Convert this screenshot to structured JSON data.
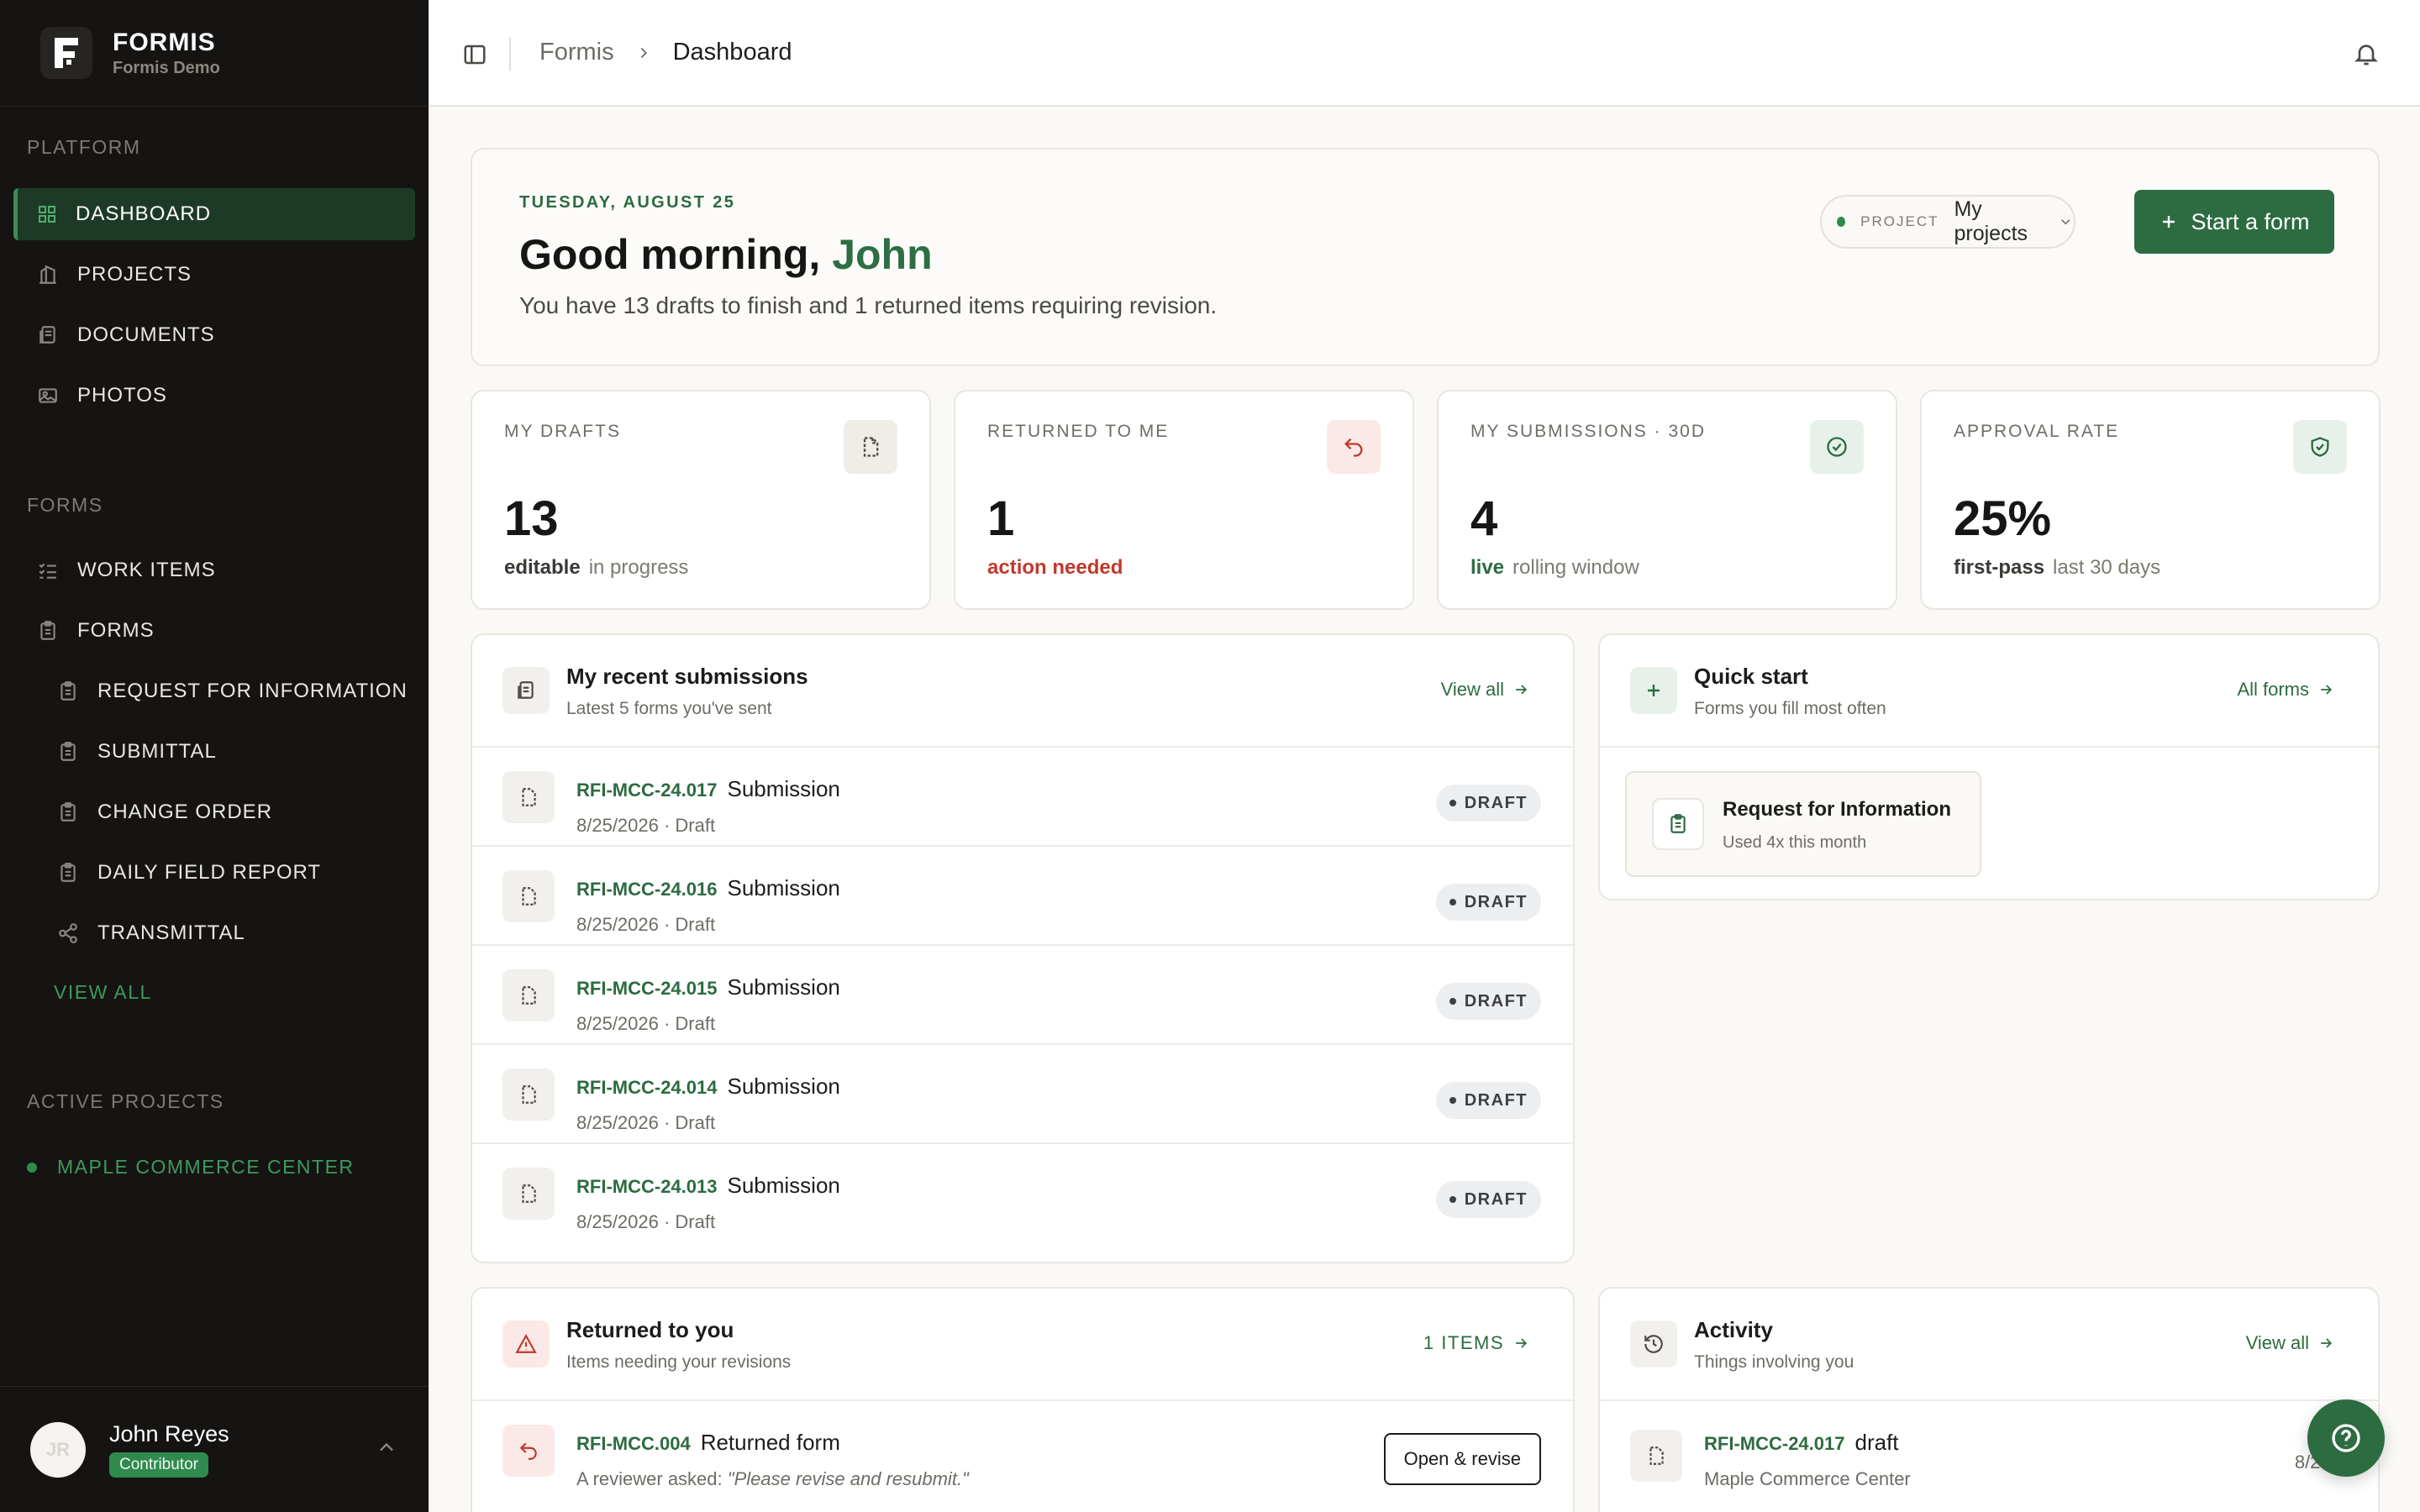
{
  "brand": {
    "name": "FORMIS",
    "subtitle": "Formis Demo"
  },
  "sidebar": {
    "platform_label": "PLATFORM",
    "platform_items": [
      {
        "label": "DASHBOARD",
        "icon": "grid-icon",
        "active": true
      },
      {
        "label": "PROJECTS",
        "icon": "building-icon"
      },
      {
        "label": "DOCUMENTS",
        "icon": "documents-icon"
      },
      {
        "label": "PHOTOS",
        "icon": "photos-icon"
      }
    ],
    "forms_label": "FORMS",
    "forms_items": [
      {
        "label": "WORK ITEMS",
        "icon": "list-check-icon"
      },
      {
        "label": "FORMS",
        "icon": "clipboard-icon"
      },
      {
        "label": "REQUEST FOR INFORMATION",
        "icon": "clipboard-icon"
      },
      {
        "label": "SUBMITTAL",
        "icon": "clipboard-icon"
      },
      {
        "label": "CHANGE ORDER",
        "icon": "clipboard-icon"
      },
      {
        "label": "DAILY FIELD REPORT",
        "icon": "clipboard-icon"
      },
      {
        "label": "TRANSMITTAL",
        "icon": "share-icon"
      }
    ],
    "view_all": "VIEW ALL",
    "active_projects_label": "ACTIVE PROJECTS",
    "active_project": "MAPLE COMMERCE CENTER"
  },
  "user": {
    "initials": "JR",
    "name": "John Reyes",
    "role": "Contributor"
  },
  "breadcrumb": {
    "root": "Formis",
    "current": "Dashboard"
  },
  "hero": {
    "date": "TUESDAY, AUGUST 25",
    "greeting": "Good morning,",
    "name": "John",
    "summary": "You have 13 drafts to finish and 1 returned items requiring revision.",
    "project_label": "PROJECT",
    "project_value": "My projects",
    "start_button": "Start a form"
  },
  "stats": [
    {
      "label": "MY DRAFTS",
      "value": "13",
      "strong": "editable",
      "muted": "in progress",
      "icon": "draft-file-icon"
    },
    {
      "label": "RETURNED TO ME",
      "value": "1",
      "strong": "action needed",
      "muted": "",
      "icon": "return-arrow-icon"
    },
    {
      "label": "MY SUBMISSIONS · 30D",
      "value": "4",
      "strong": "live",
      "muted": "rolling window",
      "icon": "check-circle-icon"
    },
    {
      "label": "APPROVAL RATE",
      "value": "25%",
      "strong": "first-pass",
      "muted": "last 30 days",
      "icon": "shield-check-icon"
    }
  ],
  "recent": {
    "title": "My recent submissions",
    "subtitle": "Latest 5 forms you've sent",
    "link": "View all",
    "rows": [
      {
        "code": "RFI-MCC-24.017",
        "title": "Submission",
        "meta": "8/25/2026 · Draft",
        "status": "DRAFT"
      },
      {
        "code": "RFI-MCC-24.016",
        "title": "Submission",
        "meta": "8/25/2026 · Draft",
        "status": "DRAFT"
      },
      {
        "code": "RFI-MCC-24.015",
        "title": "Submission",
        "meta": "8/25/2026 · Draft",
        "status": "DRAFT"
      },
      {
        "code": "RFI-MCC-24.014",
        "title": "Submission",
        "meta": "8/25/2026 · Draft",
        "status": "DRAFT"
      },
      {
        "code": "RFI-MCC-24.013",
        "title": "Submission",
        "meta": "8/25/2026 · Draft",
        "status": "DRAFT"
      }
    ]
  },
  "quick": {
    "title": "Quick start",
    "subtitle": "Forms you fill most often",
    "link": "All forms",
    "tile_title": "Request for Information",
    "tile_sub": "Used 4x this month"
  },
  "returned": {
    "title": "Returned to you",
    "subtitle": "Items needing your revisions",
    "link": "1 ITEMS",
    "row": {
      "code": "RFI-MCC.004",
      "title": "Returned form",
      "meta_prefix": "A reviewer asked:",
      "quote": "\"Please revise and resubmit.\"",
      "button": "Open & revise"
    }
  },
  "activity": {
    "title": "Activity",
    "subtitle": "Things involving you",
    "link": "View all",
    "row": {
      "code": "RFI-MCC-24.017",
      "title": "draft",
      "meta": "Maple Commerce Center",
      "date": "8/25/2"
    }
  },
  "colors": {
    "accent": "#2d6b41",
    "sidebar_bg": "#151412",
    "danger": "#c0392b"
  }
}
